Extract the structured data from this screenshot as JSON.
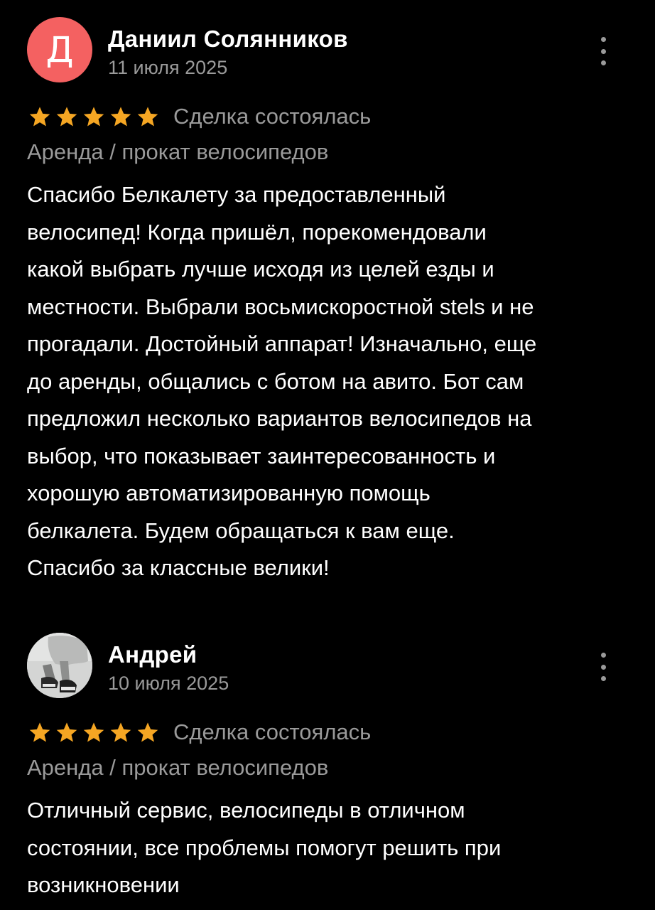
{
  "reviews": [
    {
      "avatar_letter": "Д",
      "avatar_color": "#f46161",
      "author": "Даниил Солянников",
      "date": "11 июля 2025",
      "rating": 5,
      "status": "Сделка состоялась",
      "category": "Аренда / прокат велосипедов",
      "text": "Спасибо Белкалету за предоставленный\nвелосипед! Когда пришёл, порекомендовали\nкакой выбрать лучше исходя из целей езды и\nместности. Выбрали восьмискоростной stels и не\nпрогадали. Достойный аппарат! Изначально, еще\nдо аренды, общались с ботом на авито. Бот сам\nпредложил несколько вариантов велосипедов на\nвыбор, что показывает заинтересованность и\nхорошую автоматизированную помощь\nбелкалета. Будем обращаться к вам еще.\nСпасибо за классные велики!",
      "more_icon": "more-vertical-icon"
    },
    {
      "avatar_icon": "avatar-photo",
      "author": "Андрей",
      "date": "10 июля 2025",
      "rating": 5,
      "status": "Сделка состоялась",
      "category": "Аренда / прокат велосипедов",
      "text": "Отличный сервис, велосипеды в отличном\nсостоянии, все проблемы помогут решить при\nвозникновении",
      "more_icon": "more-vertical-icon"
    }
  ],
  "colors": {
    "background": "#000000",
    "star": "#f5a623",
    "secondary_text": "#9a9a9a",
    "primary_text": "#ffffff"
  }
}
